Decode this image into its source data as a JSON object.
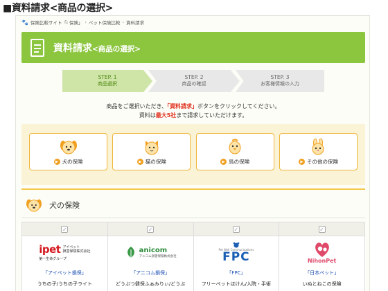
{
  "caption": "■資料請求<商品の選択>",
  "breadcrumb": [
    "保険比較サイト「i 保険」",
    "ペット保険比較",
    "資料請求"
  ],
  "banner": {
    "title": "資料請求",
    "subtitle": "<商品の選択>"
  },
  "steps": [
    {
      "en": "STEP. 1",
      "label": "商品選択",
      "active": true
    },
    {
      "en": "STEP. 2",
      "label": "商品の確認",
      "active": false
    },
    {
      "en": "STEP. 3",
      "label": "お客様情報の入力",
      "active": false
    }
  ],
  "instructions": {
    "line1_a": "商品をご選択いただき、",
    "line1_em": "「資料請求」",
    "line1_b": "ボタンをクリックしてください。",
    "line2_a": "資料は",
    "line2_em": "最大5社",
    "line2_b": "まで請求していただけます。"
  },
  "categories": [
    {
      "label": "犬の保険",
      "icon": "dog-icon"
    },
    {
      "label": "猫の保険",
      "icon": "cat-icon"
    },
    {
      "label": "鳥の保険",
      "icon": "bird-icon"
    },
    {
      "label": "その他の保険",
      "icon": "rabbit-icon"
    }
  ],
  "section": {
    "title": "犬の保険"
  },
  "insurers": [
    {
      "logo": {
        "brand": "ipet",
        "kana_1": "アイペット",
        "kana_2": "損害保険株式会社",
        "group": "第一生命グループ"
      },
      "link": "「アイペット損保」",
      "product": "うちの子/うちの子ライト"
    },
    {
      "logo": {
        "brand": "anicom",
        "sub": "アニコム損害保険株式会社"
      },
      "link": "「アニコム損保」",
      "product": "どうぶつ健保ふぁみりぃ/どうぶ"
    },
    {
      "logo": {
        "brand": "FPC",
        "tiny": "Pet Well Communications"
      },
      "link": "「FPC」",
      "product": "フリーペットほけん/入院・手術"
    },
    {
      "logo": {
        "brand": "NihonPet"
      },
      "link": "「日本ペット」",
      "product": "いぬとねこの保険"
    }
  ],
  "colors": {
    "green": "#8cc63f",
    "orange": "#f0a020",
    "link": "#1a4db3",
    "red": "#e0301e"
  }
}
